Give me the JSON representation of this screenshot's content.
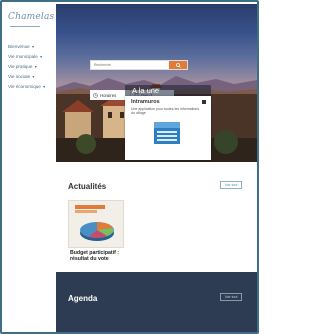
{
  "sidebar": {
    "logo": "Chamelas",
    "items": [
      {
        "label": "Bienvenue",
        "caret": "▾"
      },
      {
        "label": "Vie municipale",
        "caret": "▾"
      },
      {
        "label": "Vie pratique",
        "caret": "▾"
      },
      {
        "label": "Vie sociale",
        "caret": "▾"
      },
      {
        "label": "Vie économique",
        "caret": "▾"
      }
    ]
  },
  "hero": {
    "search": {
      "placeholder": "Recherche"
    },
    "quicklinks": [
      {
        "label": "Horaires",
        "icon": "clock-icon"
      },
      {
        "label": "Vos d"
      }
    ],
    "card": {
      "header": "A la une",
      "title": "Intramuros",
      "description": "Une application pour toutes les informations du village"
    }
  },
  "news": {
    "title": "Actualités",
    "see_all": "Voir tout",
    "items": [
      {
        "title": "Budget participatif : résultat du vote"
      }
    ]
  },
  "agenda": {
    "title": "Agenda",
    "see_all": "Voir tout"
  },
  "colors": {
    "accent": "#e07b3a",
    "frame": "#3f6f86",
    "agenda_bg": "#2d3c52"
  }
}
